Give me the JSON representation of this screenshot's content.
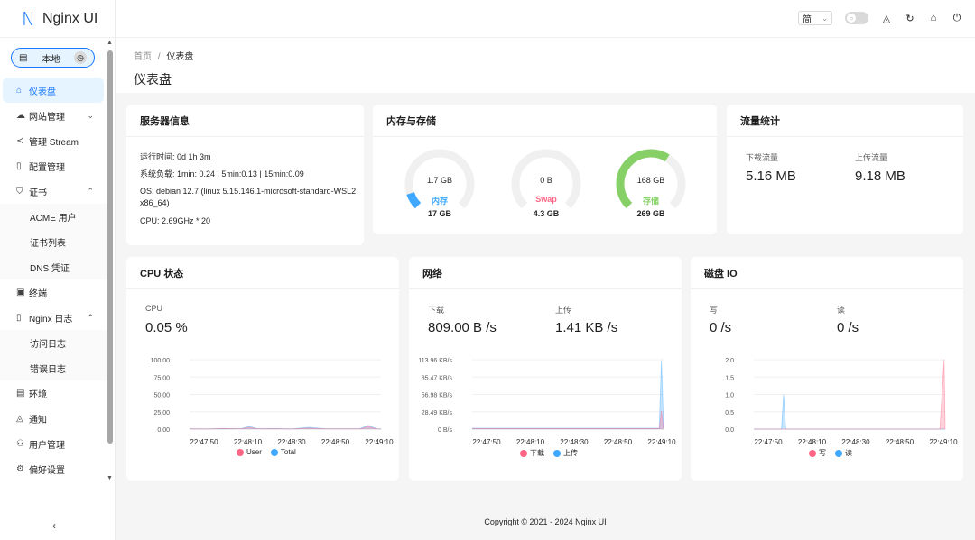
{
  "app": {
    "title": "Nginx UI",
    "logo_mark": "N"
  },
  "environment": {
    "label": "本地"
  },
  "sidebar": {
    "items": [
      {
        "label": "仪表盘",
        "icon": "home-icon",
        "glyph": "⌂",
        "active": true
      },
      {
        "label": "网站管理",
        "icon": "cloud-icon",
        "glyph": "☁",
        "chevron": "⌄"
      },
      {
        "label": "管理 Stream",
        "icon": "share-icon",
        "glyph": "≺"
      },
      {
        "label": "配置管理",
        "icon": "file-icon",
        "glyph": "▯"
      },
      {
        "label": "证书",
        "icon": "shield-icon",
        "glyph": "⛉",
        "chevron": "⌃"
      },
      {
        "label": "ACME 用户",
        "sub": true
      },
      {
        "label": "证书列表",
        "sub": true
      },
      {
        "label": "DNS 凭证",
        "sub": true
      },
      {
        "label": "终端",
        "icon": "terminal-icon",
        "glyph": "▣"
      },
      {
        "label": "Nginx 日志",
        "icon": "file-text-icon",
        "glyph": "▯",
        "chevron": "⌃"
      },
      {
        "label": "访问日志",
        "sub": true
      },
      {
        "label": "错误日志",
        "sub": true
      },
      {
        "label": "环境",
        "icon": "database-icon",
        "glyph": "▤"
      },
      {
        "label": "通知",
        "icon": "bell-icon",
        "glyph": "◬"
      },
      {
        "label": "用户管理",
        "icon": "user-icon",
        "glyph": "⚇"
      },
      {
        "label": "偏好设置",
        "icon": "settings-icon",
        "glyph": "⚙"
      }
    ],
    "collapse": "‹"
  },
  "header": {
    "lang": "简"
  },
  "breadcrumb": {
    "home": "首页",
    "sep": "/",
    "current": "仪表盘"
  },
  "page_title": "仪表盘",
  "server_info": {
    "title": "服务器信息",
    "uptime": "运行时间: 0d 1h 3m",
    "load": "系统负载: 1min: 0.24 | 5min:0.13 | 15min:0.09",
    "os": "OS: debian 12.7 (linux 5.15.146.1-microsoft-standard-WSL2 x86_64)",
    "cpu": "CPU: 2.69GHz * 20"
  },
  "memory": {
    "title": "内存与存储",
    "gauges": [
      {
        "value": "1.7 GB",
        "label": "内存",
        "total": "17 GB",
        "percent": 10,
        "color": "#40a9ff"
      },
      {
        "value": "0 B",
        "label": "Swap",
        "total": "4.3 GB",
        "percent": 0,
        "color": "#ff6685"
      },
      {
        "value": "168 GB",
        "label": "存储",
        "total": "269 GB",
        "percent": 62,
        "color": "#87d068"
      }
    ]
  },
  "traffic": {
    "title": "流量统计",
    "down_label": "下载流量",
    "down_value": "5.16 MB",
    "up_label": "上传流量",
    "up_value": "9.18 MB"
  },
  "cpu_status": {
    "title": "CPU 状态",
    "label": "CPU",
    "value": "0.05 %"
  },
  "network": {
    "title": "网络",
    "down_label": "下载",
    "down_value": "809.00 B /s",
    "up_label": "上传",
    "up_value": "1.41 KB /s"
  },
  "disk": {
    "title": "磁盘 IO",
    "write_label": "写",
    "write_value": "0 /s",
    "read_label": "读",
    "read_value": "0 /s"
  },
  "chart_data": [
    {
      "type": "area",
      "y_ticks": [
        "100.00",
        "75.00",
        "50.00",
        "25.00",
        "0.00"
      ],
      "ylim": [
        0,
        100
      ],
      "x_ticks": [
        "22:47:50",
        "22:48:10",
        "22:48:30",
        "22:48:50",
        "22:49:10"
      ],
      "xlim": [
        0,
        90
      ],
      "series": [
        {
          "name": "User",
          "color": "#ff6685",
          "x": [
            0,
            8,
            16,
            24,
            28,
            32,
            40,
            48,
            56,
            64,
            72,
            80,
            84,
            88,
            90
          ],
          "values": [
            0.3,
            0.2,
            0.8,
            0.3,
            2.5,
            0.3,
            0.5,
            0.2,
            1.5,
            0.3,
            0.3,
            0.3,
            3.5,
            0.3,
            0.2
          ]
        },
        {
          "name": "Total",
          "color": "#40a9ff",
          "x": [
            0,
            8,
            16,
            24,
            28,
            32,
            40,
            48,
            56,
            64,
            72,
            80,
            84,
            88,
            90
          ],
          "values": [
            0.5,
            0.3,
            1.0,
            0.5,
            4.0,
            0.5,
            0.7,
            0.3,
            2.5,
            0.5,
            0.5,
            0.5,
            5.5,
            0.5,
            0.3
          ]
        }
      ]
    },
    {
      "type": "area",
      "y_ticks": [
        "113.96 KB/s",
        "85.47 KB/s",
        "56.98 KB/s",
        "28.49 KB/s",
        "0 B/s"
      ],
      "ylim": [
        0,
        113.96
      ],
      "x_ticks": [
        "22:47:50",
        "22:48:10",
        "22:48:30",
        "22:48:50",
        "22:49:10"
      ],
      "xlim": [
        0,
        90
      ],
      "series": [
        {
          "name": "下载",
          "color": "#ff6685",
          "x": [
            0,
            10,
            20,
            30,
            40,
            50,
            60,
            70,
            80,
            86,
            88,
            89,
            90
          ],
          "values": [
            0.8,
            0.8,
            0.8,
            0.8,
            0.8,
            0.8,
            0.8,
            0.8,
            0.8,
            0.8,
            0.8,
            30,
            1
          ]
        },
        {
          "name": "上传",
          "color": "#40a9ff",
          "x": [
            0,
            10,
            20,
            30,
            40,
            50,
            60,
            70,
            80,
            86,
            88,
            89,
            90
          ],
          "values": [
            1.4,
            1.4,
            1.4,
            1.4,
            1.4,
            1.4,
            1.4,
            1.4,
            1.4,
            1.4,
            1.4,
            113,
            2
          ]
        }
      ]
    },
    {
      "type": "area",
      "y_ticks": [
        "2.0",
        "1.5",
        "1.0",
        "0.5",
        "0.0"
      ],
      "ylim": [
        0,
        2
      ],
      "x_ticks": [
        "22:47:50",
        "22:48:10",
        "22:48:30",
        "22:48:50",
        "22:49:10"
      ],
      "xlim": [
        0,
        90
      ],
      "series": [
        {
          "name": "写",
          "color": "#ff6685",
          "x": [
            0,
            87.5,
            89.5,
            90
          ],
          "values": [
            0,
            0,
            2,
            0
          ]
        },
        {
          "name": "读",
          "color": "#40a9ff",
          "x": [
            0,
            13,
            14,
            15,
            90
          ],
          "values": [
            0,
            0,
            1,
            0,
            0
          ]
        }
      ]
    }
  ],
  "footer": "Copyright © 2021 - 2024 Nginx UI"
}
